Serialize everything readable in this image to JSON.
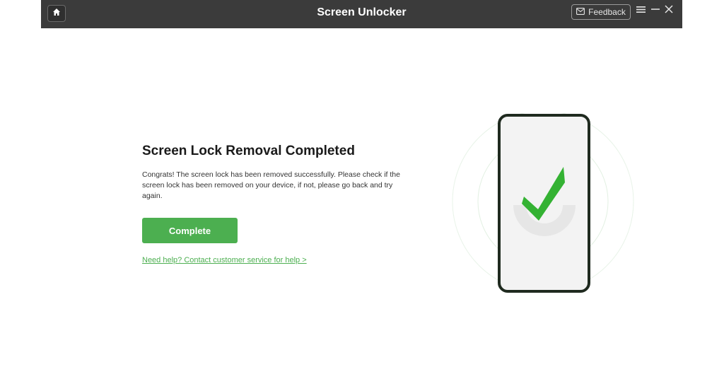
{
  "titlebar": {
    "title": "Screen Unlocker",
    "feedback_label": "Feedback",
    "icons": [
      "home-icon",
      "mail-icon",
      "menu-icon",
      "minimize-icon",
      "close-icon"
    ]
  },
  "main": {
    "heading": "Screen Lock Removal Completed",
    "description": "Congrats! The screen lock has been removed successfully. Please check if the screen lock has been removed on your device, if not, please go back and try again.",
    "complete_label": "Complete",
    "help_link": "Need help? Contact customer service for help >"
  },
  "illustration": {
    "icon": "phone-check-icon"
  },
  "colors": {
    "titlebar_bg": "#3b3b3b",
    "accent_green": "#4caf50",
    "check_green": "#34b233",
    "phone_border": "#1f2a1f"
  }
}
